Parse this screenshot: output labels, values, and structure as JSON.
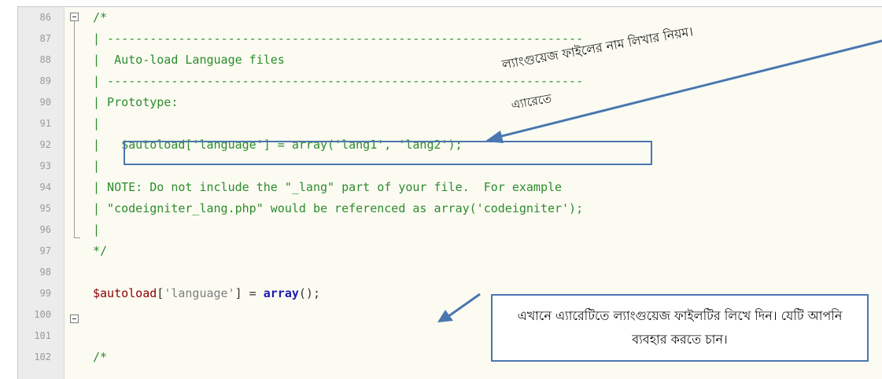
{
  "editor": {
    "lines": [
      {
        "num": "86",
        "segments": [
          {
            "cls": "c-comment",
            "text": "/*"
          }
        ]
      },
      {
        "num": "87",
        "segments": [
          {
            "cls": "c-comment",
            "text": "| -------------------------------------------------------------------"
          }
        ]
      },
      {
        "num": "88",
        "segments": [
          {
            "cls": "c-comment",
            "text": "|  Auto-load Language files"
          }
        ]
      },
      {
        "num": "89",
        "segments": [
          {
            "cls": "c-comment",
            "text": "| -------------------------------------------------------------------"
          }
        ]
      },
      {
        "num": "90",
        "segments": [
          {
            "cls": "c-comment",
            "text": "| Prototype:"
          }
        ]
      },
      {
        "num": "91",
        "segments": [
          {
            "cls": "c-comment",
            "text": "|"
          }
        ]
      },
      {
        "num": "92",
        "segments": [
          {
            "cls": "c-comment",
            "text": "|   $autoload['language'] = array('lang1', 'lang2');"
          }
        ]
      },
      {
        "num": "93",
        "segments": [
          {
            "cls": "c-comment",
            "text": "|"
          }
        ]
      },
      {
        "num": "94",
        "segments": [
          {
            "cls": "c-comment",
            "text": "| NOTE: Do not include the \"_lang\" part of your file.  For example"
          }
        ]
      },
      {
        "num": "95",
        "segments": [
          {
            "cls": "c-comment",
            "text": "| \"codeigniter_lang.php\" would be referenced as array('codeigniter');"
          }
        ]
      },
      {
        "num": "96",
        "segments": [
          {
            "cls": "c-comment",
            "text": "|"
          }
        ]
      },
      {
        "num": "97",
        "segments": [
          {
            "cls": "c-comment",
            "text": "*/"
          }
        ]
      },
      {
        "num": "98",
        "segments": []
      },
      {
        "num": "99",
        "segments": [
          {
            "cls": "c-var",
            "text": "$autoload"
          },
          {
            "cls": "c-punc",
            "text": "["
          },
          {
            "cls": "c-str",
            "text": "'language'"
          },
          {
            "cls": "c-punc",
            "text": "] = "
          },
          {
            "cls": "c-fn",
            "text": "array"
          },
          {
            "cls": "c-punc",
            "text": "();"
          }
        ]
      },
      {
        "num": "100",
        "segments": []
      },
      {
        "num": "101",
        "segments": []
      },
      {
        "num": "102",
        "segments": [
          {
            "cls": "c-comment",
            "text": "/*"
          }
        ]
      }
    ]
  },
  "annotations": {
    "top_note": "ল্যাংগুয়েজ ফাইলের নাম লিখার নিয়ম।",
    "array_note": "এ্যারেতে",
    "callout_text": "এখানে এ্যারেটিতে ল্যাংগুয়েজ ফাইলটির লিখে দিন। যেটি আপনি ব্যবহার করতে চান।"
  },
  "colors": {
    "comment": "#2e8b2e",
    "variable": "#8b0000",
    "string": "#7f7f7f",
    "function": "#1b1bb0",
    "annotation_border": "#4b76b0",
    "editor_bg": "#fbfbf2",
    "gutter_bg": "#ececec"
  }
}
